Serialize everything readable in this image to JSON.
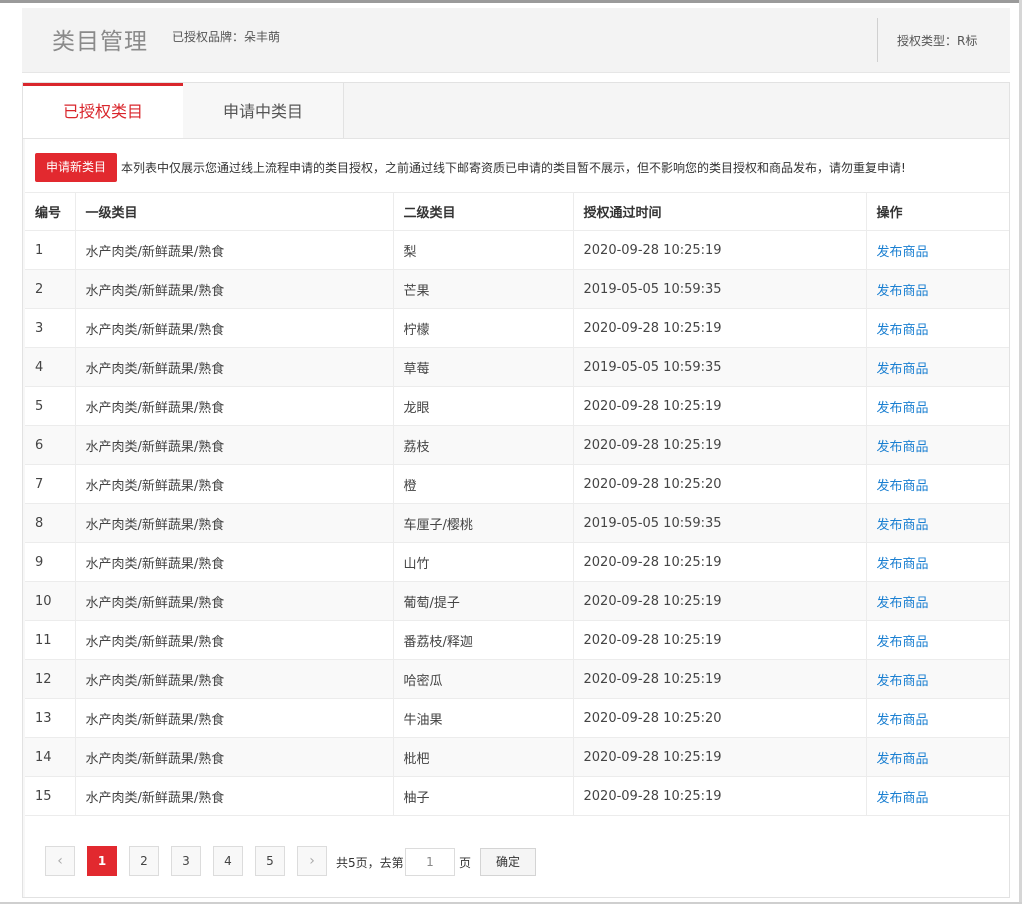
{
  "header": {
    "title": "类目管理",
    "brand_label": "已授权品牌：朵丰萌",
    "auth_type": "授权类型：R标"
  },
  "tabs": [
    {
      "label": "已授权类目",
      "active": true
    },
    {
      "label": "申请中类目",
      "active": false
    }
  ],
  "notice": {
    "button_label": "申请新类目",
    "text": "本列表中仅展示您通过线上流程申请的类目授权，之前通过线下邮寄资质已申请的类目暂不展示，但不影响您的类目授权和商品发布，请勿重复申请!"
  },
  "table": {
    "columns": [
      "编号",
      "一级类目",
      "二级类目",
      "授权通过时间",
      "操作"
    ],
    "rows": [
      {
        "id": "1",
        "level1": "水产肉类/新鲜蔬果/熟食",
        "level2": "梨",
        "time": "2020-09-28 10:25:19",
        "action": "发布商品"
      },
      {
        "id": "2",
        "level1": "水产肉类/新鲜蔬果/熟食",
        "level2": "芒果",
        "time": "2019-05-05 10:59:35",
        "action": "发布商品"
      },
      {
        "id": "3",
        "level1": "水产肉类/新鲜蔬果/熟食",
        "level2": "柠檬",
        "time": "2020-09-28 10:25:19",
        "action": "发布商品"
      },
      {
        "id": "4",
        "level1": "水产肉类/新鲜蔬果/熟食",
        "level2": "草莓",
        "time": "2019-05-05 10:59:35",
        "action": "发布商品"
      },
      {
        "id": "5",
        "level1": "水产肉类/新鲜蔬果/熟食",
        "level2": "龙眼",
        "time": "2020-09-28 10:25:19",
        "action": "发布商品"
      },
      {
        "id": "6",
        "level1": "水产肉类/新鲜蔬果/熟食",
        "level2": "荔枝",
        "time": "2020-09-28 10:25:19",
        "action": "发布商品"
      },
      {
        "id": "7",
        "level1": "水产肉类/新鲜蔬果/熟食",
        "level2": "橙",
        "time": "2020-09-28 10:25:20",
        "action": "发布商品"
      },
      {
        "id": "8",
        "level1": "水产肉类/新鲜蔬果/熟食",
        "level2": "车厘子/樱桃",
        "time": "2019-05-05 10:59:35",
        "action": "发布商品"
      },
      {
        "id": "9",
        "level1": "水产肉类/新鲜蔬果/熟食",
        "level2": "山竹",
        "time": "2020-09-28 10:25:19",
        "action": "发布商品"
      },
      {
        "id": "10",
        "level1": "水产肉类/新鲜蔬果/熟食",
        "level2": "葡萄/提子",
        "time": "2020-09-28 10:25:19",
        "action": "发布商品"
      },
      {
        "id": "11",
        "level1": "水产肉类/新鲜蔬果/熟食",
        "level2": "番荔枝/释迦",
        "time": "2020-09-28 10:25:19",
        "action": "发布商品"
      },
      {
        "id": "12",
        "level1": "水产肉类/新鲜蔬果/熟食",
        "level2": "哈密瓜",
        "time": "2020-09-28 10:25:19",
        "action": "发布商品"
      },
      {
        "id": "13",
        "level1": "水产肉类/新鲜蔬果/熟食",
        "level2": "牛油果",
        "time": "2020-09-28 10:25:20",
        "action": "发布商品"
      },
      {
        "id": "14",
        "level1": "水产肉类/新鲜蔬果/熟食",
        "level2": "枇杷",
        "time": "2020-09-28 10:25:19",
        "action": "发布商品"
      },
      {
        "id": "15",
        "level1": "水产肉类/新鲜蔬果/熟食",
        "level2": "柚子",
        "time": "2020-09-28 10:25:19",
        "action": "发布商品"
      }
    ]
  },
  "pagination": {
    "prev_icon": "chevron-left-icon",
    "next_icon": "chevron-right-icon",
    "pages": [
      "1",
      "2",
      "3",
      "4",
      "5"
    ],
    "current_page": "1",
    "total_text": "共5页，去第",
    "goto_value": "1",
    "page_suffix": "页",
    "confirm_label": "确定"
  },
  "colors": {
    "accent": "#e2292f",
    "link": "#1a7fd1"
  }
}
